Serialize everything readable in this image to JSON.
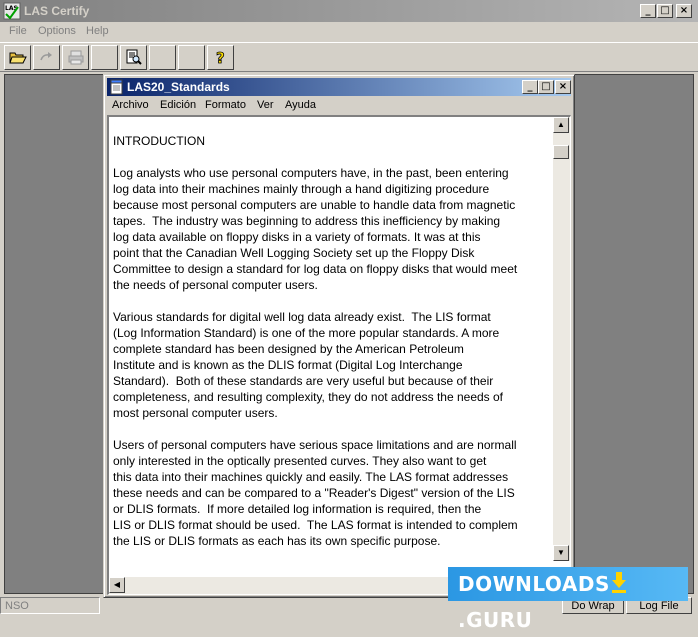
{
  "app": {
    "title": "LAS Certify",
    "menu": [
      "File",
      "Options",
      "Help"
    ],
    "caption_buttons": {
      "minimize": "_",
      "maximize": "□",
      "close": "×"
    }
  },
  "toolbar": {
    "buttons": [
      {
        "icon": "open-folder-icon"
      },
      {
        "icon": "redo-icon"
      },
      {
        "icon": "print-icon"
      },
      {
        "icon": "blank"
      },
      {
        "icon": "print-preview-icon"
      },
      {
        "icon": "blank"
      },
      {
        "icon": "blank"
      },
      {
        "icon": "help-icon",
        "label": "?"
      }
    ]
  },
  "document_window": {
    "title": "LAS20_Standards",
    "menu": [
      "Archivo",
      "Edición",
      "Formato",
      "Ver",
      "Ayuda"
    ],
    "caption_buttons": {
      "minimize": "_",
      "maximize": "□",
      "close": "×"
    },
    "text": "INTRODUCTION\n\nLog analysts who use personal computers have, in the past, been entering\nlog data into their machines mainly through a hand digitizing procedure\nbecause most personal computers are unable to handle data from magnetic\ntapes.  The industry was beginning to address this inefficiency by making\nlog data available on floppy disks in a variety of formats. It was at this\npoint that the Canadian Well Logging Society set up the Floppy Disk\nCommittee to design a standard for log data on floppy disks that would meet\nthe needs of personal computer users.\n\nVarious standards for digital well log data already exist.  The LIS format\n(Log Information Standard) is one of the more popular standards. A more\ncomplete standard has been designed by the American Petroleum\nInstitute and is known as the DLIS format (Digital Log Interchange\nStandard).  Both of these standards are very useful but because of their\ncompleteness, and resulting complexity, they do not address the needs of\nmost personal computer users.\n\nUsers of personal computers have serious space limitations and are normall\nonly interested in the optically presented curves. They also want to get\nthis data into their machines quickly and easily. The LAS format addresses\nthese needs and can be compared to a \"Reader's Digest\" version of the LIS\nor DLIS formats.  If more detailed log information is required, then the\nLIS or DLIS format should be used.  The LAS format is intended to complem\nthe LIS or DLIS formats as each has its own specific purpose."
  },
  "statusbar": {
    "left": "NSO",
    "do_wrap": "Do Wrap",
    "log_file": "Log File"
  },
  "watermark": {
    "prefix": "DOWNLOADS",
    "suffix": ".GURU",
    "accent": "#ffd200"
  },
  "colors": {
    "window_bg": "#d4d0c8",
    "active_title": "#0a246a",
    "inactive_title": "#808080",
    "workspace": "#808080"
  }
}
